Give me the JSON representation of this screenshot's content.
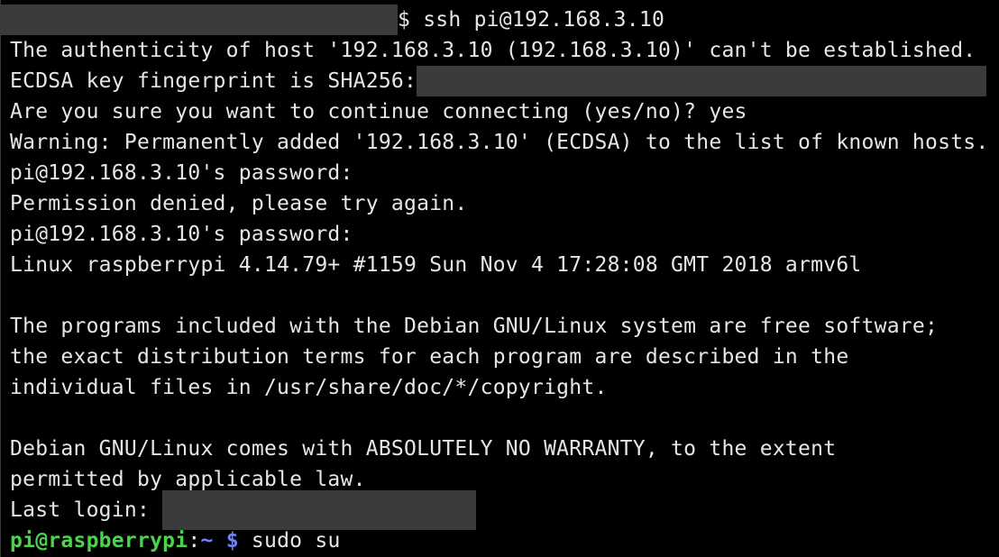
{
  "terminal": {
    "first_command": "$ ssh pi@192.168.3.10",
    "lines": {
      "authenticity": "The authenticity of host '192.168.3.10 (192.168.3.10)' can't be established.",
      "fingerprint_label": "ECDSA key fingerprint is SHA256:",
      "confirm": "Are you sure you want to continue connecting (yes/no)? yes",
      "warning": "Warning: Permanently added '192.168.3.10' (ECDSA) to the list of known hosts.",
      "password_prompt_1": "pi@192.168.3.10's password:",
      "denied": "Permission denied, please try again.",
      "password_prompt_2": "pi@192.168.3.10's password:",
      "uname": "Linux raspberrypi 4.14.79+ #1159 Sun Nov 4 17:28:08 GMT 2018 armv6l",
      "programs_1": "The programs included with the Debian GNU/Linux system are free software;",
      "programs_2": "the exact distribution terms for each program are described in the",
      "programs_3": "individual files in /usr/share/doc/*/copyright.",
      "warranty_1": "Debian GNU/Linux comes with ABSOLUTELY NO WARRANTY, to the extent",
      "warranty_2": "permitted by applicable law.",
      "last_login_label": "Last login: "
    },
    "prompt": {
      "user_host": "pi@raspberrypi",
      "separator": ":",
      "path": "~",
      "dollar": " $",
      "command": " sudo su"
    },
    "colors": {
      "background": "#000000",
      "text": "#e6e6e6",
      "prompt_user": "#4cd34c",
      "prompt_path": "#6e82ff",
      "redaction": "#3b3b3b"
    }
  }
}
